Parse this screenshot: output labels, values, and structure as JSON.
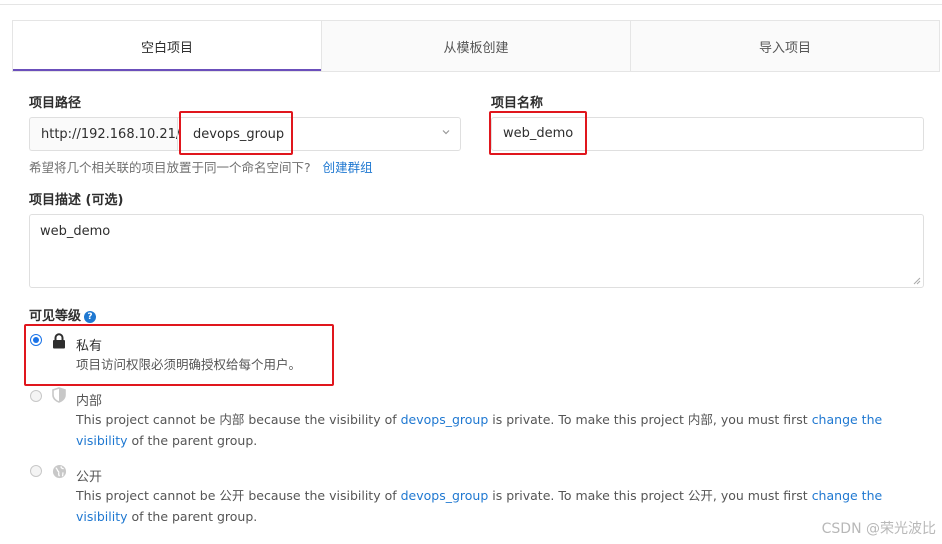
{
  "tabs": [
    {
      "label": "空白项目",
      "active": true
    },
    {
      "label": "从模板创建",
      "active": false
    },
    {
      "label": "导入项目",
      "active": false
    }
  ],
  "path": {
    "label": "项目路径",
    "prefix": "http://192.168.10.21/",
    "group_value": "devops_group"
  },
  "name": {
    "label": "项目名称",
    "value": "web_demo"
  },
  "help": {
    "text": "希望将几个相关联的项目放置于同一个命名空间下?",
    "link": "创建群组"
  },
  "description": {
    "label": "项目描述 (可选)",
    "value": "web_demo"
  },
  "visibility": {
    "label": "可见等级",
    "help_icon": "?",
    "options": [
      {
        "title": "私有",
        "desc": "项目访问权限必须明确授权给每个用户。",
        "selected": true,
        "icon": "lock-icon"
      },
      {
        "title": "内部",
        "desc_pre": "This project cannot be 内部 because the visibility of ",
        "group_link": "devops_group",
        "desc_mid": " is private. To make this project 内部, you must first ",
        "change_link_1": "change the",
        "change_link_2": "visibility",
        "desc_post": " of the parent group.",
        "selected": false,
        "icon": "shield-icon"
      },
      {
        "title": "公开",
        "desc_pre": "This project cannot be 公开 because the visibility of ",
        "group_link": "devops_group",
        "desc_mid": " is private. To make this project 公开, you must first ",
        "change_link_1": "change the",
        "change_link_2": "visibility",
        "desc_post": " of the parent group.",
        "selected": false,
        "icon": "globe-icon"
      }
    ]
  },
  "watermark": "CSDN @荣光波比",
  "colors": {
    "accent": "#6b4fbb",
    "link": "#1f78d1",
    "highlight": "#e0161d"
  }
}
